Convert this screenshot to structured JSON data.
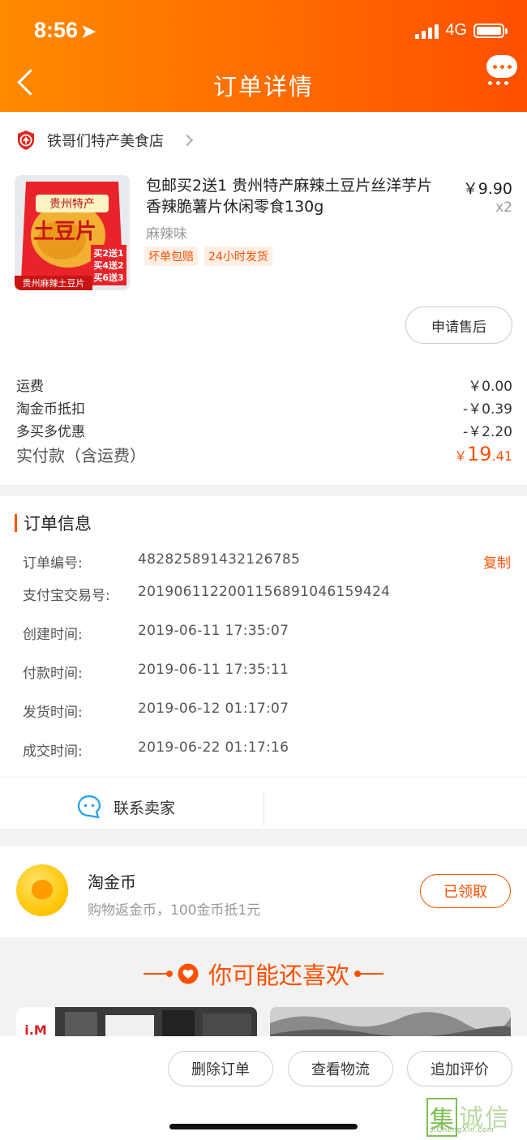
{
  "status_bar": {
    "time": "8:56",
    "network": "4G"
  },
  "nav": {
    "title": "订单详情"
  },
  "shop": {
    "name": "铁哥们特产美食店"
  },
  "product": {
    "title": "包邮买2送1 贵州特产麻辣土豆片丝洋芋片 香辣脆薯片休闲零食130g",
    "price": "￥9.90",
    "quantity": "x2",
    "spec": "麻辣味",
    "tags": [
      "坏单包赔",
      "24小时发货"
    ],
    "image": {
      "brand": "贵州特产",
      "name": "土豆片",
      "promos": [
        "买2送1",
        "买4送2",
        "买6送3"
      ],
      "caption": "贵州麻辣土豆片"
    },
    "after_sale_label": "申请售后"
  },
  "fees": [
    {
      "label": "运费",
      "value": "￥0.00"
    },
    {
      "label": "淘金币抵扣",
      "value": "-￥0.39"
    },
    {
      "label": "多买多优惠",
      "value": "-￥2.20"
    }
  ],
  "total": {
    "label": "实付款（含运费）",
    "currency": "￥",
    "integer": "19",
    "decimal": ".41"
  },
  "order_info": {
    "heading": "订单信息",
    "copy_label": "复制",
    "rows": [
      {
        "label": "订单编号:",
        "value": "482825891432126785"
      },
      {
        "label": "支付宝交易号:",
        "value": "2019061122001156891046159424"
      },
      {
        "label": "创建时间:",
        "value": "2019-06-11 17:35:07"
      },
      {
        "label": "付款时间:",
        "value": "2019-06-11 17:35:11"
      },
      {
        "label": "发货时间:",
        "value": "2019-06-12 01:17:07"
      },
      {
        "label": "成交时间:",
        "value": "2019-06-22 01:17:16"
      }
    ],
    "contact_label": "联系卖家"
  },
  "coin": {
    "title": "淘金币",
    "subtitle": "购物返金币，100金币抵1元",
    "button": "已领取"
  },
  "recommend": {
    "title": "你可能还喜欢",
    "thumb_label": "i.M"
  },
  "bottom_actions": [
    "删除订单",
    "查看物流",
    "追加评价"
  ],
  "watermark": {
    "chars": [
      "集",
      "诚",
      "信"
    ],
    "url": "JiChengXin.com"
  },
  "colors": {
    "accent": "#ff5000",
    "header_start": "#ff8a00",
    "header_end": "#ff4f00"
  }
}
